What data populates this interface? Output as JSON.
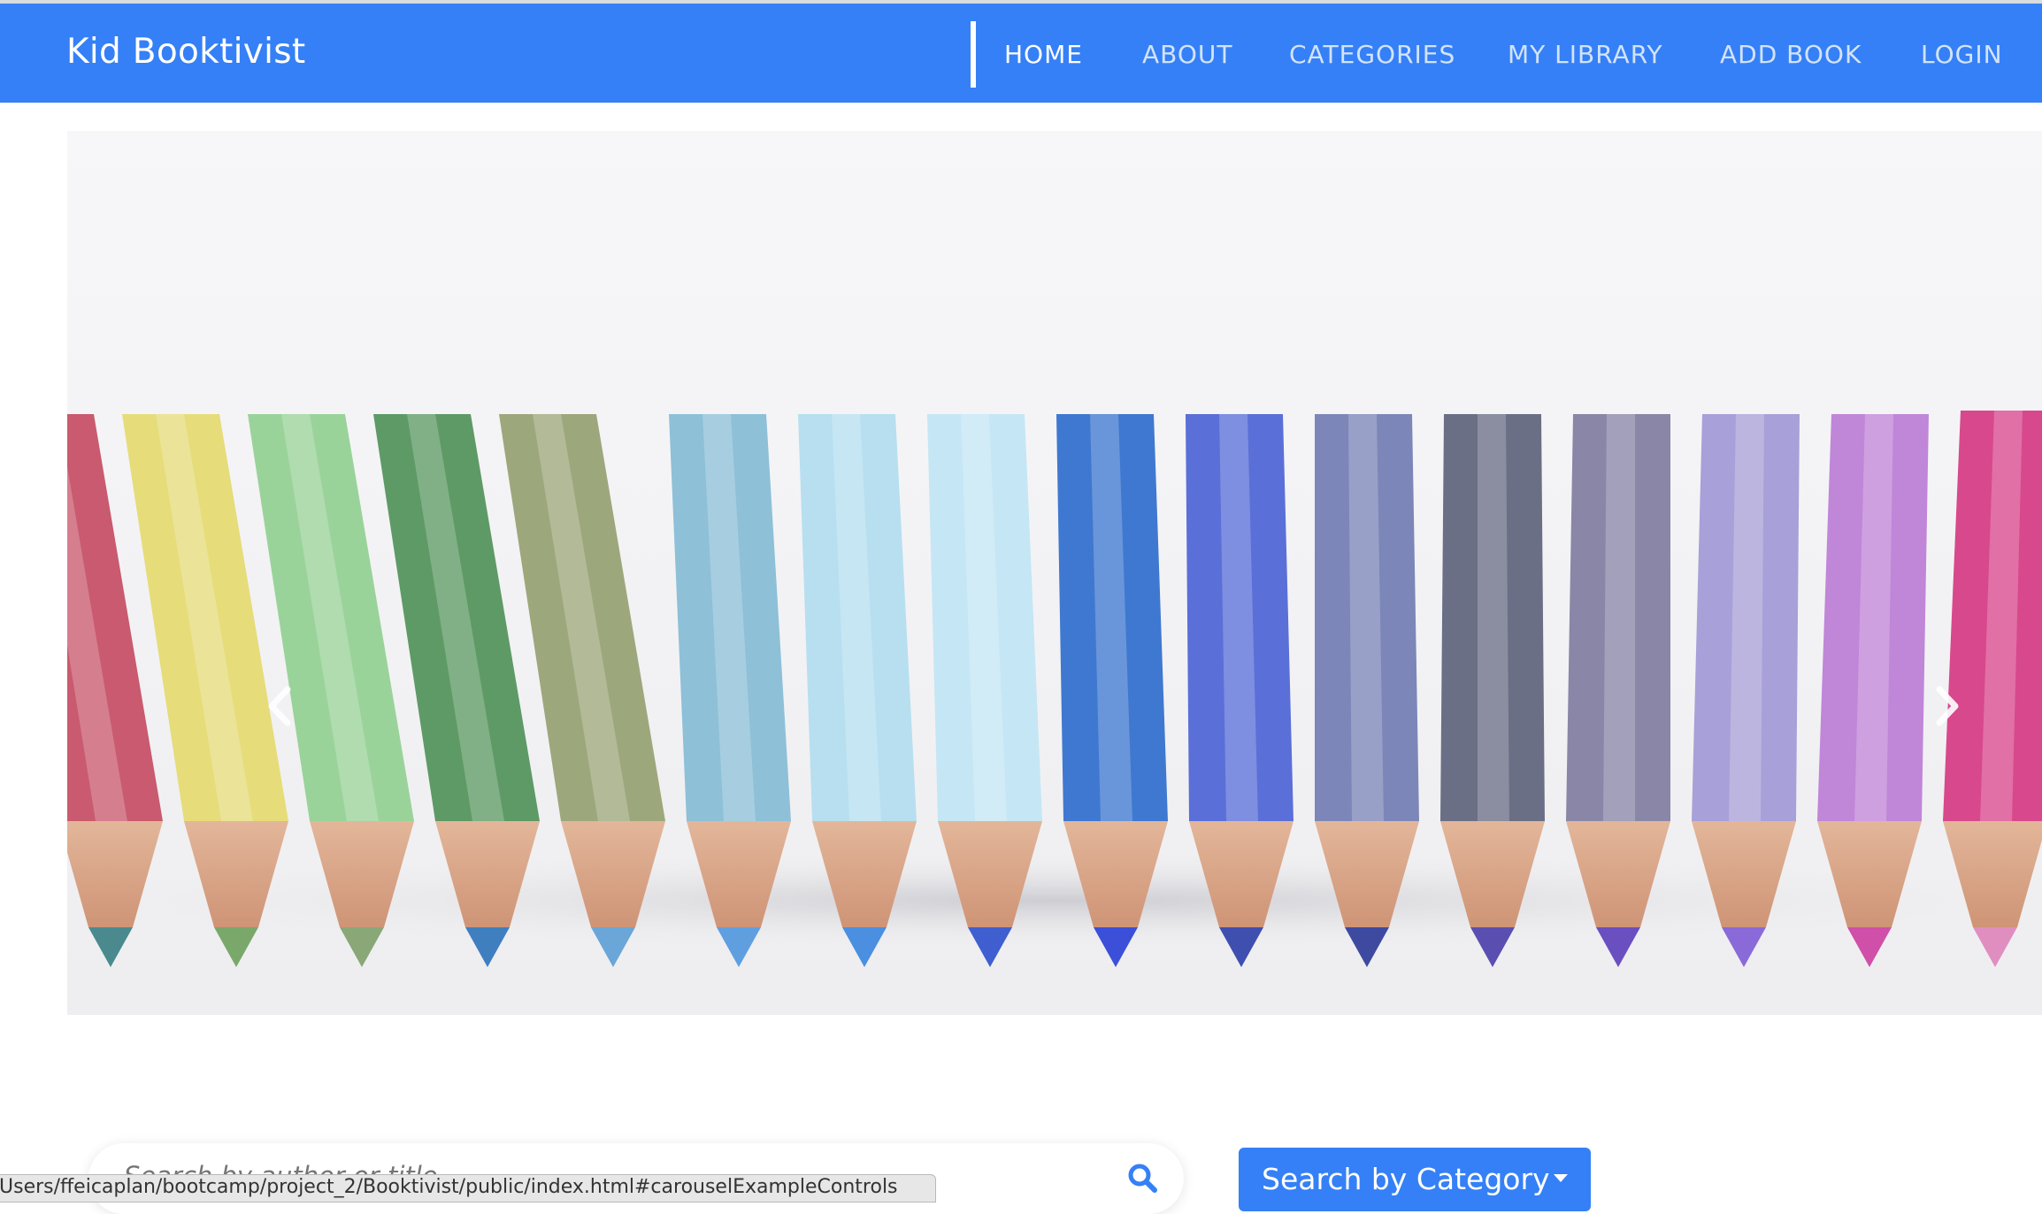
{
  "navbar": {
    "brand": "Kid Booktivist",
    "bg_color": "#3580f6",
    "links": [
      {
        "label": "HOME",
        "active": true
      },
      {
        "label": "ABOUT",
        "active": false
      },
      {
        "label": "CATEGORIES",
        "active": false
      },
      {
        "label": "MY LIBRARY",
        "active": false
      },
      {
        "label": "ADD BOOK",
        "active": false
      },
      {
        "label": "LOGIN",
        "active": false
      }
    ]
  },
  "carousel": {
    "image": "colored-pencils-photo",
    "prev_icon": "chevron-left-icon",
    "next_icon": "chevron-right-icon"
  },
  "search": {
    "placeholder": "Search by author or title",
    "icon": "search-icon"
  },
  "category_dropdown": {
    "label": "Search by Category",
    "icon": "caret-down-icon"
  },
  "status_bar": {
    "url": "Users/ffeicaplan/bootcamp/project_2/Booktivist/public/index.html#carouselExampleControls"
  }
}
